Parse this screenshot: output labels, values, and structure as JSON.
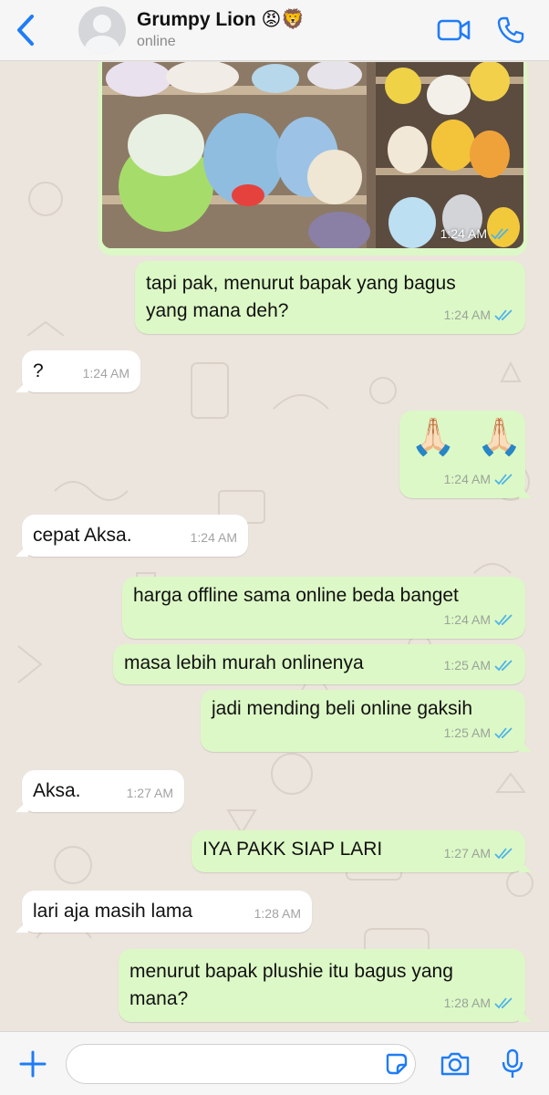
{
  "header": {
    "contact_name": "Grumpy Lion 😡🦁",
    "status": "online"
  },
  "colors": {
    "accent": "#1f7cf6",
    "outgoing_bubble": "#dcf8c6",
    "incoming_bubble": "#ffffff",
    "read_tick": "#4fb3e8"
  },
  "image_message": {
    "time": "1:24 AM",
    "description_icon": "photo-thumbnail"
  },
  "messages": [
    {
      "dir": "out",
      "lines": [
        "tapi pak, menurut bapak yang bagus",
        "yang mana deh?"
      ],
      "time": "1:24 AM",
      "read": true
    },
    {
      "dir": "in",
      "lines": [
        "?"
      ],
      "time": "1:24 AM"
    },
    {
      "dir": "out",
      "lines": [
        "🙏🏻 🙏🏻"
      ],
      "time": "1:24 AM",
      "read": true,
      "emoji": true
    },
    {
      "dir": "in",
      "lines": [
        "cepat Aksa."
      ],
      "time": "1:24 AM"
    },
    {
      "dir": "out",
      "lines": [
        "harga offline sama online beda banget"
      ],
      "time": "1:24 AM",
      "read": true
    },
    {
      "dir": "out",
      "lines": [
        "masa lebih murah onlinenya"
      ],
      "time": "1:25 AM",
      "read": true
    },
    {
      "dir": "out",
      "lines": [
        "jadi mending beli online gaksih"
      ],
      "time": "1:25 AM",
      "read": true
    },
    {
      "dir": "in",
      "lines": [
        "Aksa."
      ],
      "time": "1:27 AM"
    },
    {
      "dir": "out",
      "lines": [
        "IYA PAKK SIAP LARI"
      ],
      "time": "1:27 AM",
      "read": true
    },
    {
      "dir": "in",
      "lines": [
        "lari aja masih lama"
      ],
      "time": "1:28 AM"
    },
    {
      "dir": "out",
      "lines": [
        "menurut bapak plushie itu bagus yang",
        "mana?"
      ],
      "time": "1:28 AM",
      "read": true
    }
  ],
  "composer": {
    "placeholder": "",
    "value": ""
  }
}
